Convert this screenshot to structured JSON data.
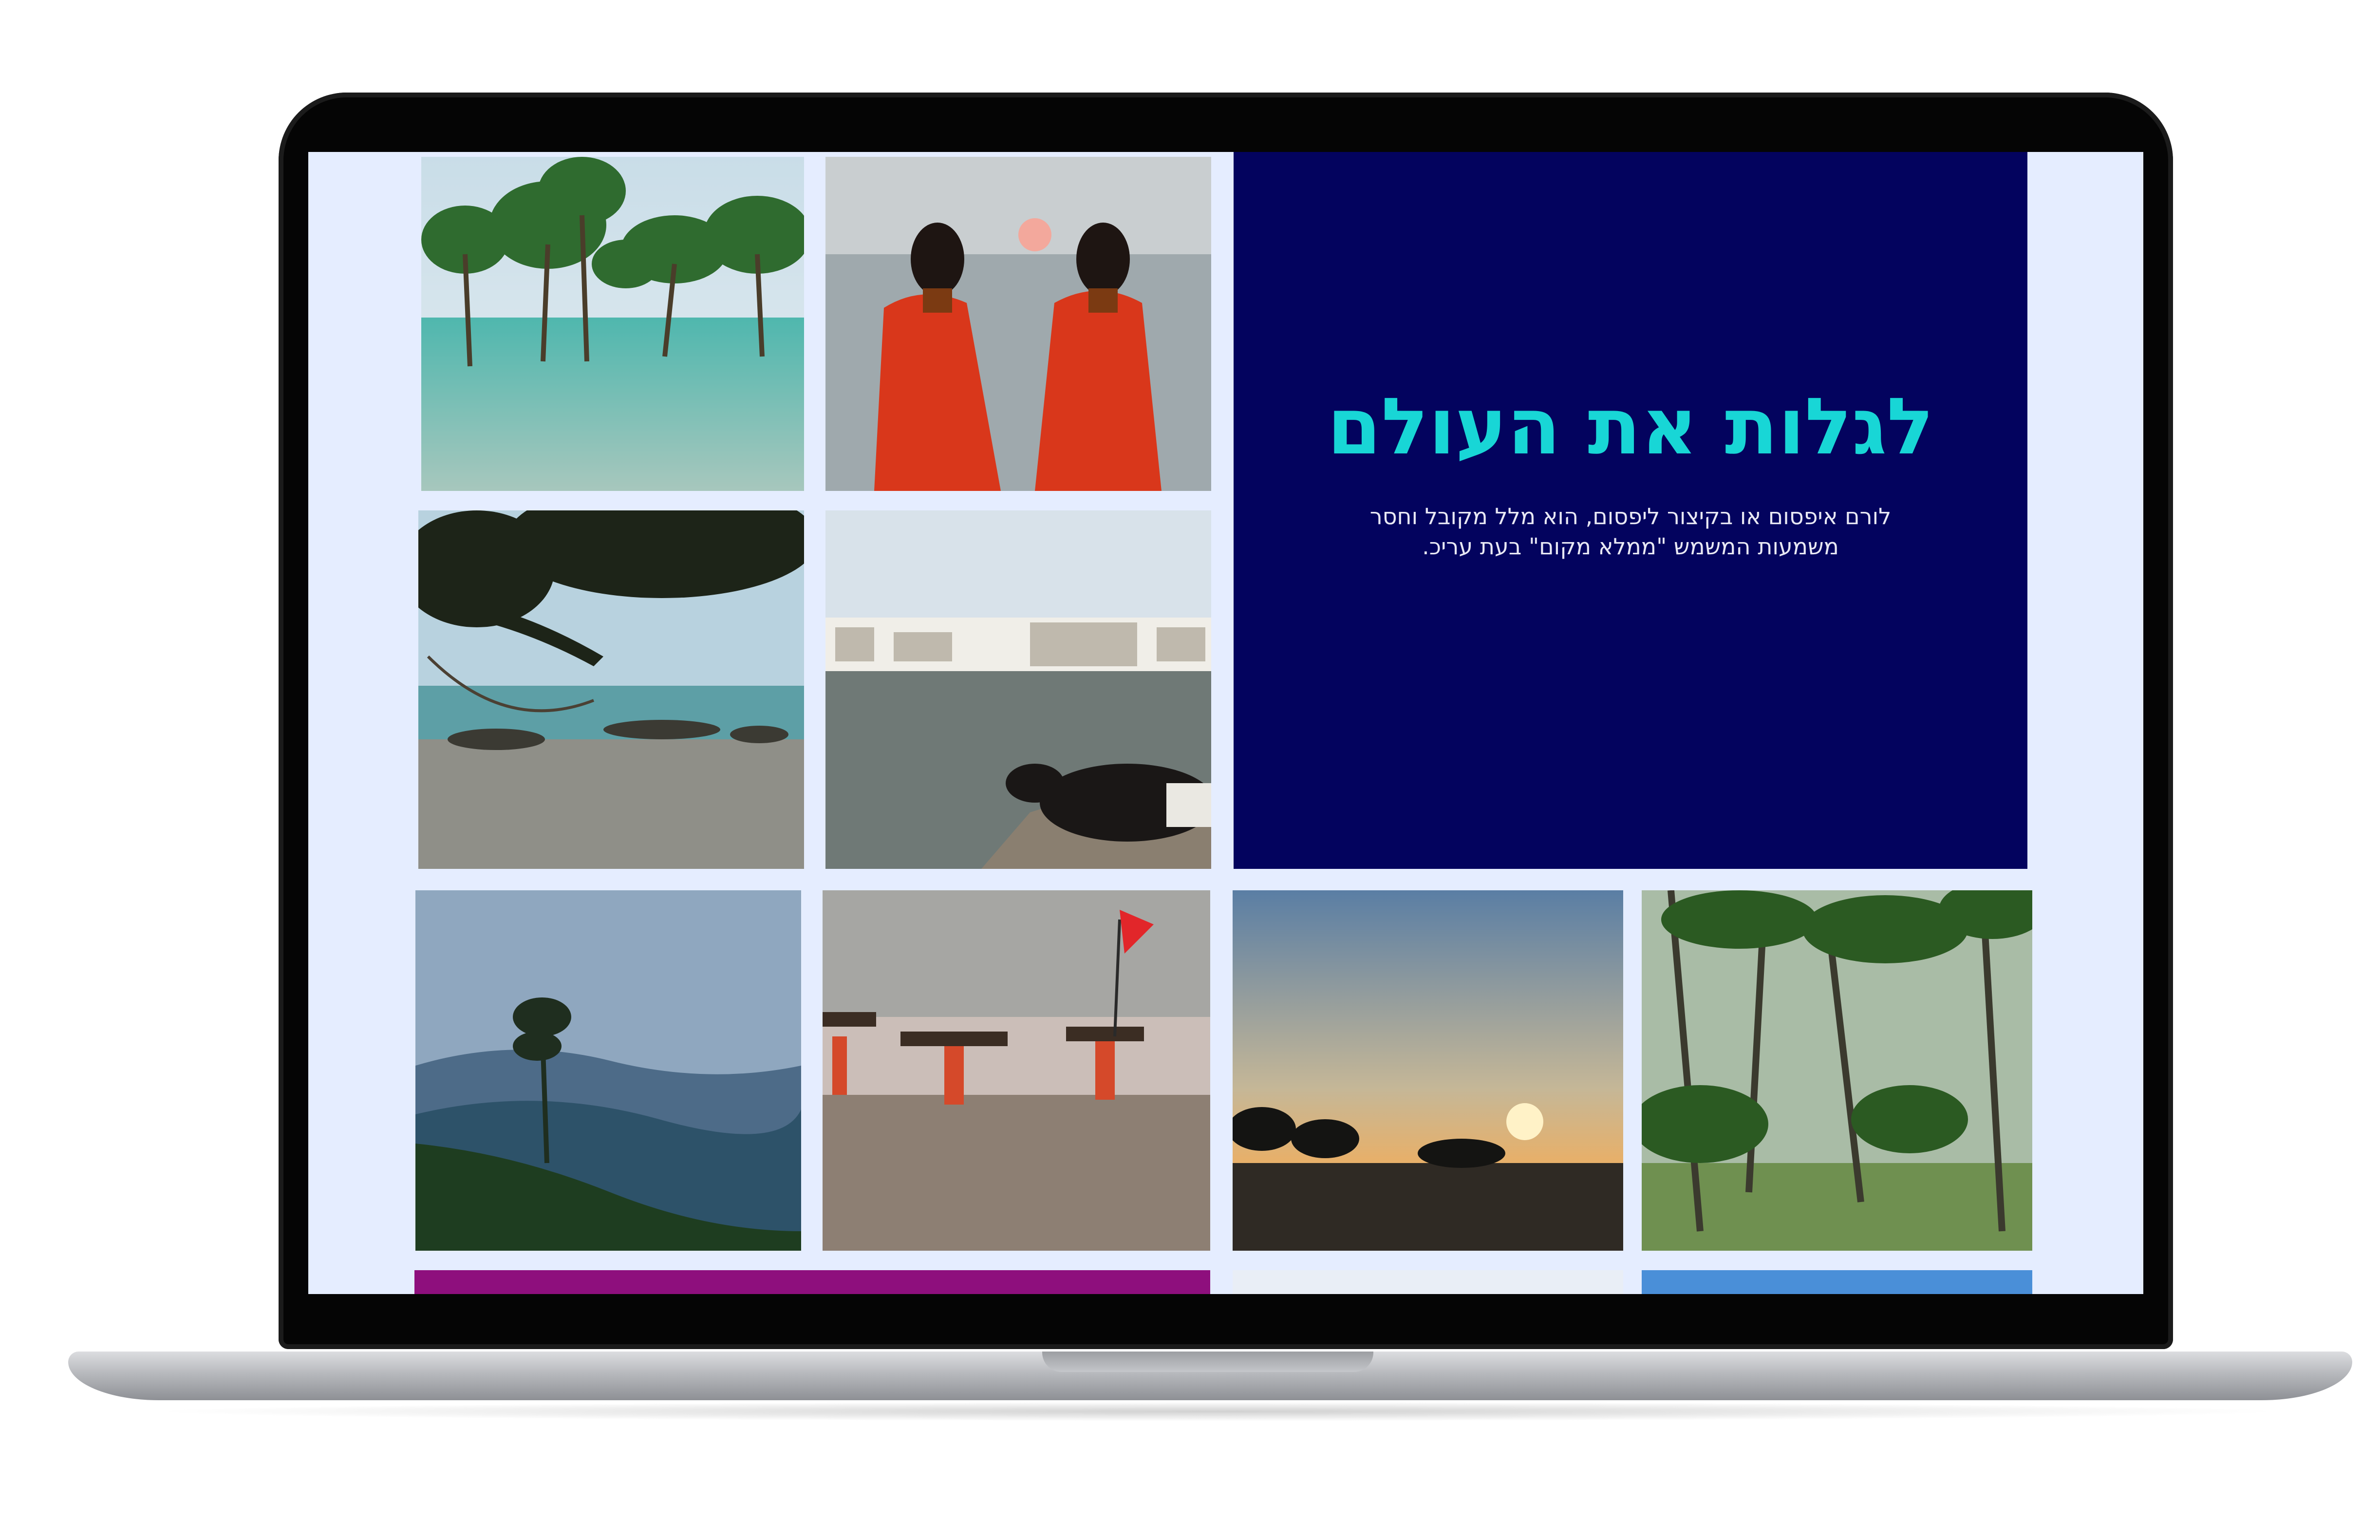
{
  "hero": {
    "title": "לגלות את העולם",
    "text": "לורם איפסום או בקיצור ליפסום, הוא מלל מקובל וחסר משמעות המשמש \"ממלא מקום\" בעת עריכ."
  },
  "colors": {
    "page_background": "#e5edff",
    "hero_background": "#03035e",
    "hero_title": "#18d6d6",
    "strip_magenta": "#8e0f7d",
    "strip_blue": "#4a8fd8"
  },
  "gallery": {
    "tiles": [
      {
        "name": "mangrove-trees-photo"
      },
      {
        "name": "two-women-sunset-photo"
      },
      {
        "name": "beach-hammock-photo"
      },
      {
        "name": "cow-by-lake-photo"
      },
      {
        "name": "misty-mountains-photo"
      },
      {
        "name": "people-carrying-wood-beach-photo"
      },
      {
        "name": "sunset-over-shore-photo"
      },
      {
        "name": "palm-forest-photo"
      }
    ]
  }
}
